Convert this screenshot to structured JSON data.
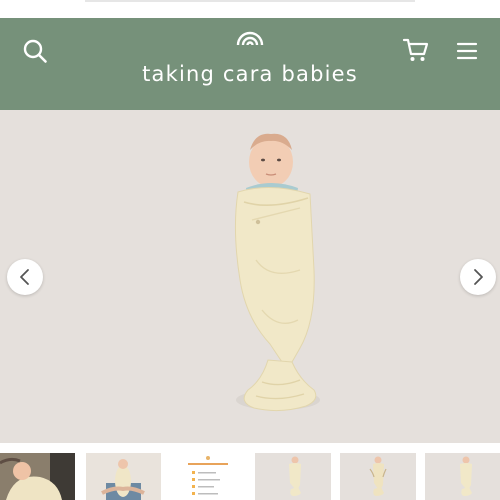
{
  "header": {
    "brand": "taking cara babies",
    "background_color": "#76917a",
    "search_icon": "search-icon",
    "cart_icon": "cart-icon",
    "menu_icon": "hamburger-menu-icon"
  },
  "gallery": {
    "background_color": "#e5e0dc",
    "prev_icon": "chevron-left-icon",
    "next_icon": "chevron-right-icon",
    "thumbnail_count": 6,
    "selected_thumbnail": 1
  }
}
